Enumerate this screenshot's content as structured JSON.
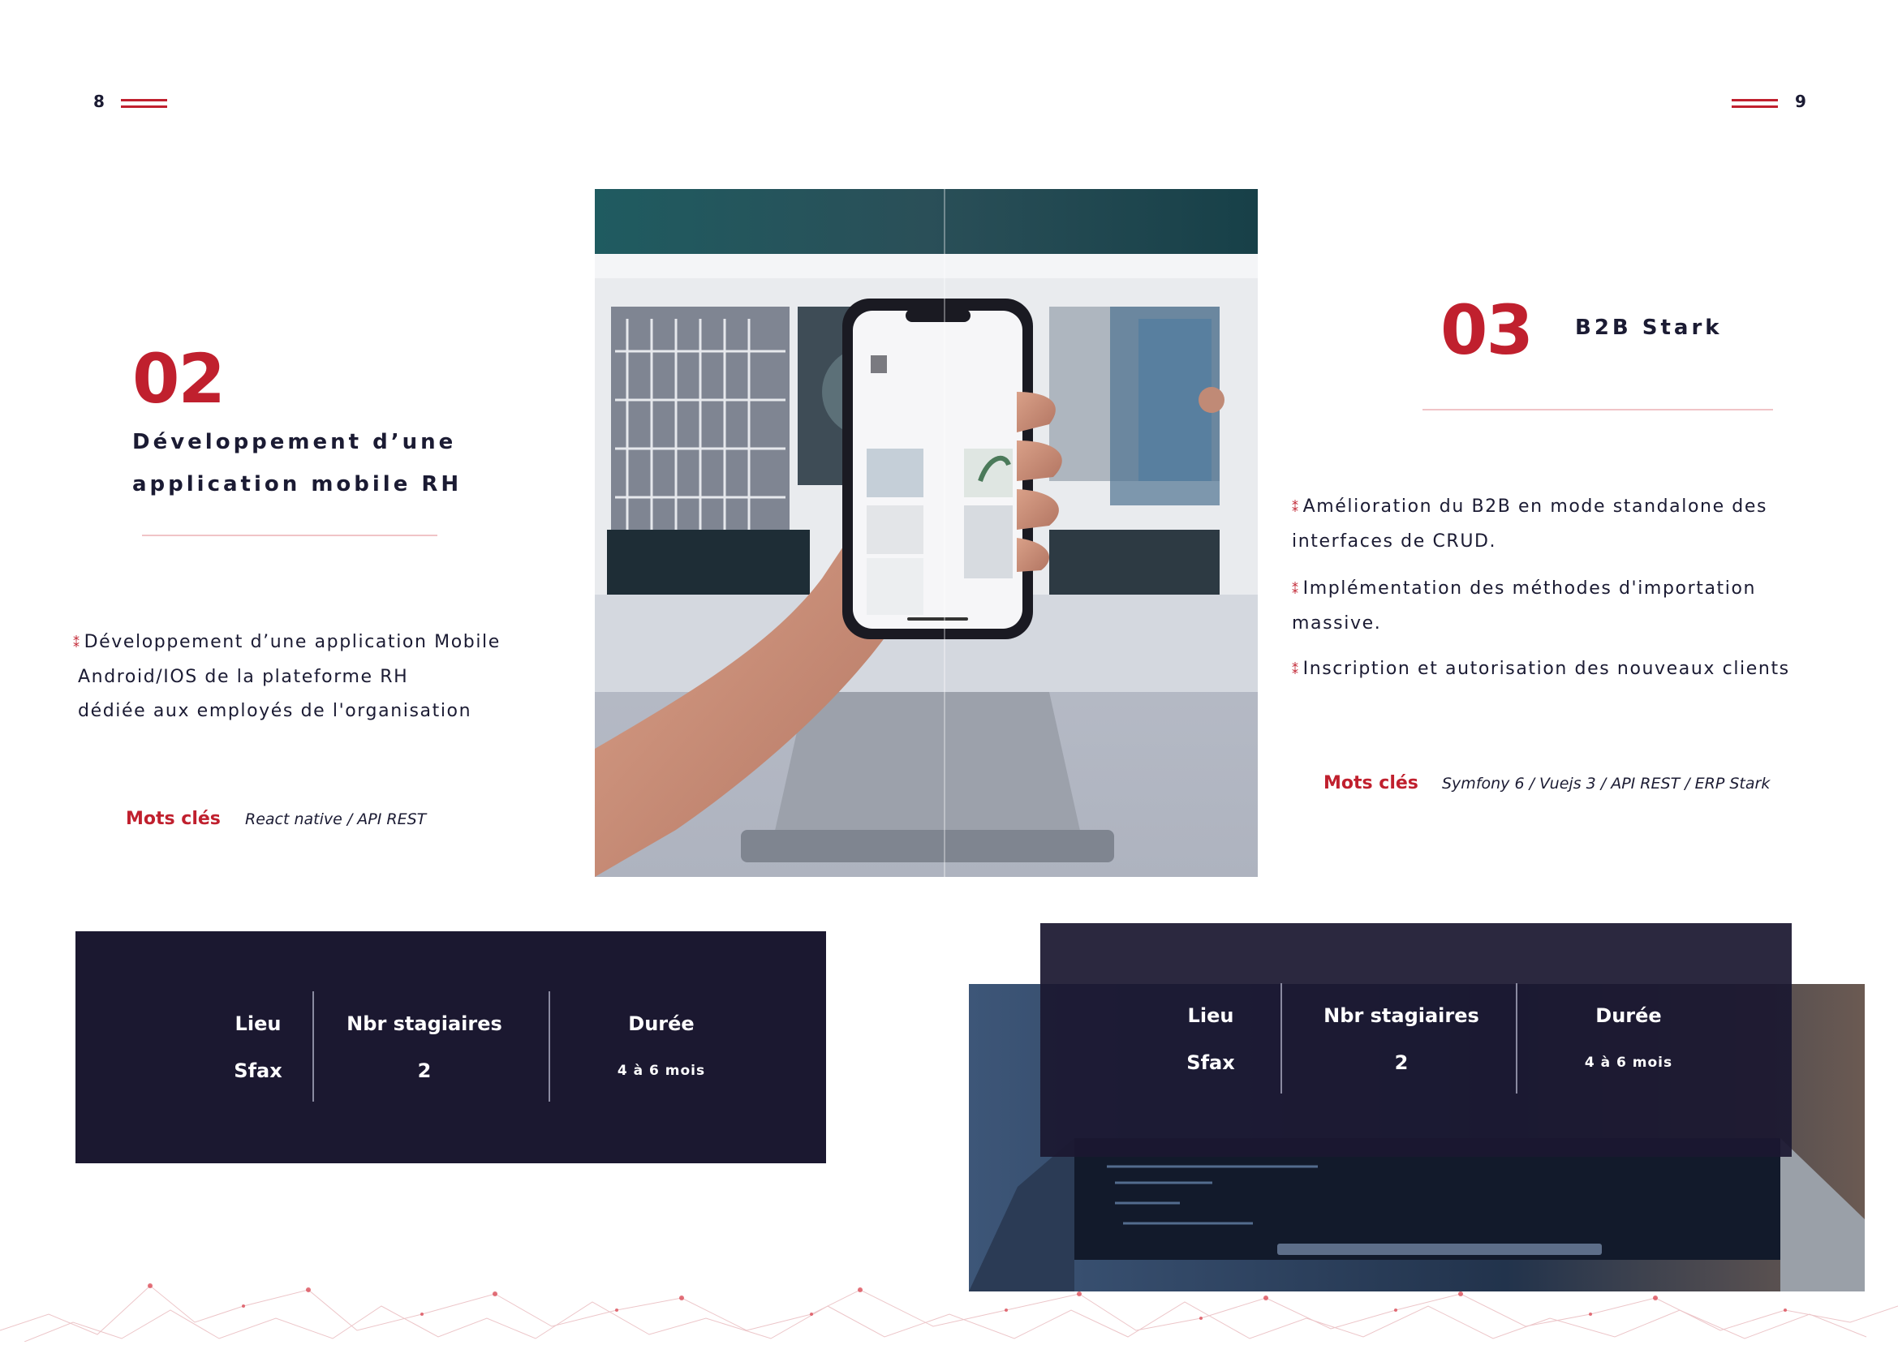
{
  "pages": {
    "left_number": "8",
    "right_number": "9"
  },
  "project_02": {
    "number": "02",
    "title_line1": "Développement d’une",
    "title_line2": "application mobile RH",
    "description_line1": "Développement d’une application Mobile",
    "description_line2": "Android/IOS de la plateforme RH",
    "description_line3": "dédiée aux employés de l'organisation",
    "keywords_label": "Mots clés",
    "keywords": "React native / API REST",
    "info": {
      "location_label": "Lieu",
      "location_value": "Sfax",
      "interns_label": "Nbr stagiaires",
      "interns_value": "2",
      "duration_label": "Durée",
      "duration_value": "4 à 6  mois"
    }
  },
  "project_03": {
    "number": "03",
    "title": "B2B Stark",
    "bullet1_line1": "Amélioration du B2B en mode standalone des",
    "bullet1_line2": "interfaces de CRUD.",
    "bullet2_line1": "Implémentation des méthodes d'importation",
    "bullet2_line2": "massive.",
    "bullet3_line1": "Inscription et autorisation des nouveaux clients",
    "keywords_label": "Mots clés",
    "keywords": "Symfony 6 / Vuejs 3 / API REST / ERP Stark",
    "info": {
      "location_label": "Lieu",
      "location_value": "Sfax",
      "interns_label": "Nbr stagiaires",
      "interns_value": "2",
      "duration_label": "Durée",
      "duration_value": "4 à 6  mois"
    }
  },
  "colors": {
    "accent": "#c0202e",
    "navy": "#1b1830",
    "text": "#1b1b33"
  },
  "icons": {
    "bullet": "star-bullet-icon"
  }
}
